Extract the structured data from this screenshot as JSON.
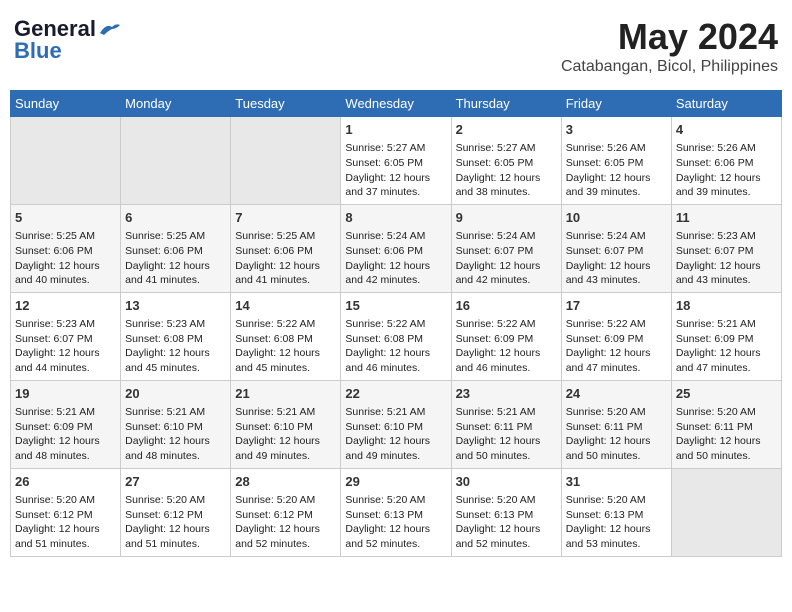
{
  "header": {
    "logo_line1": "General",
    "logo_line2": "Blue",
    "title": "May 2024",
    "subtitle": "Catabangan, Bicol, Philippines"
  },
  "calendar": {
    "days_of_week": [
      "Sunday",
      "Monday",
      "Tuesday",
      "Wednesday",
      "Thursday",
      "Friday",
      "Saturday"
    ],
    "rows": [
      [
        {
          "day": "",
          "info": ""
        },
        {
          "day": "",
          "info": ""
        },
        {
          "day": "",
          "info": ""
        },
        {
          "day": "1",
          "info": "Sunrise: 5:27 AM\nSunset: 6:05 PM\nDaylight: 12 hours\nand 37 minutes."
        },
        {
          "day": "2",
          "info": "Sunrise: 5:27 AM\nSunset: 6:05 PM\nDaylight: 12 hours\nand 38 minutes."
        },
        {
          "day": "3",
          "info": "Sunrise: 5:26 AM\nSunset: 6:05 PM\nDaylight: 12 hours\nand 39 minutes."
        },
        {
          "day": "4",
          "info": "Sunrise: 5:26 AM\nSunset: 6:06 PM\nDaylight: 12 hours\nand 39 minutes."
        }
      ],
      [
        {
          "day": "5",
          "info": "Sunrise: 5:25 AM\nSunset: 6:06 PM\nDaylight: 12 hours\nand 40 minutes."
        },
        {
          "day": "6",
          "info": "Sunrise: 5:25 AM\nSunset: 6:06 PM\nDaylight: 12 hours\nand 41 minutes."
        },
        {
          "day": "7",
          "info": "Sunrise: 5:25 AM\nSunset: 6:06 PM\nDaylight: 12 hours\nand 41 minutes."
        },
        {
          "day": "8",
          "info": "Sunrise: 5:24 AM\nSunset: 6:06 PM\nDaylight: 12 hours\nand 42 minutes."
        },
        {
          "day": "9",
          "info": "Sunrise: 5:24 AM\nSunset: 6:07 PM\nDaylight: 12 hours\nand 42 minutes."
        },
        {
          "day": "10",
          "info": "Sunrise: 5:24 AM\nSunset: 6:07 PM\nDaylight: 12 hours\nand 43 minutes."
        },
        {
          "day": "11",
          "info": "Sunrise: 5:23 AM\nSunset: 6:07 PM\nDaylight: 12 hours\nand 43 minutes."
        }
      ],
      [
        {
          "day": "12",
          "info": "Sunrise: 5:23 AM\nSunset: 6:07 PM\nDaylight: 12 hours\nand 44 minutes."
        },
        {
          "day": "13",
          "info": "Sunrise: 5:23 AM\nSunset: 6:08 PM\nDaylight: 12 hours\nand 45 minutes."
        },
        {
          "day": "14",
          "info": "Sunrise: 5:22 AM\nSunset: 6:08 PM\nDaylight: 12 hours\nand 45 minutes."
        },
        {
          "day": "15",
          "info": "Sunrise: 5:22 AM\nSunset: 6:08 PM\nDaylight: 12 hours\nand 46 minutes."
        },
        {
          "day": "16",
          "info": "Sunrise: 5:22 AM\nSunset: 6:09 PM\nDaylight: 12 hours\nand 46 minutes."
        },
        {
          "day": "17",
          "info": "Sunrise: 5:22 AM\nSunset: 6:09 PM\nDaylight: 12 hours\nand 47 minutes."
        },
        {
          "day": "18",
          "info": "Sunrise: 5:21 AM\nSunset: 6:09 PM\nDaylight: 12 hours\nand 47 minutes."
        }
      ],
      [
        {
          "day": "19",
          "info": "Sunrise: 5:21 AM\nSunset: 6:09 PM\nDaylight: 12 hours\nand 48 minutes."
        },
        {
          "day": "20",
          "info": "Sunrise: 5:21 AM\nSunset: 6:10 PM\nDaylight: 12 hours\nand 48 minutes."
        },
        {
          "day": "21",
          "info": "Sunrise: 5:21 AM\nSunset: 6:10 PM\nDaylight: 12 hours\nand 49 minutes."
        },
        {
          "day": "22",
          "info": "Sunrise: 5:21 AM\nSunset: 6:10 PM\nDaylight: 12 hours\nand 49 minutes."
        },
        {
          "day": "23",
          "info": "Sunrise: 5:21 AM\nSunset: 6:11 PM\nDaylight: 12 hours\nand 50 minutes."
        },
        {
          "day": "24",
          "info": "Sunrise: 5:20 AM\nSunset: 6:11 PM\nDaylight: 12 hours\nand 50 minutes."
        },
        {
          "day": "25",
          "info": "Sunrise: 5:20 AM\nSunset: 6:11 PM\nDaylight: 12 hours\nand 50 minutes."
        }
      ],
      [
        {
          "day": "26",
          "info": "Sunrise: 5:20 AM\nSunset: 6:12 PM\nDaylight: 12 hours\nand 51 minutes."
        },
        {
          "day": "27",
          "info": "Sunrise: 5:20 AM\nSunset: 6:12 PM\nDaylight: 12 hours\nand 51 minutes."
        },
        {
          "day": "28",
          "info": "Sunrise: 5:20 AM\nSunset: 6:12 PM\nDaylight: 12 hours\nand 52 minutes."
        },
        {
          "day": "29",
          "info": "Sunrise: 5:20 AM\nSunset: 6:13 PM\nDaylight: 12 hours\nand 52 minutes."
        },
        {
          "day": "30",
          "info": "Sunrise: 5:20 AM\nSunset: 6:13 PM\nDaylight: 12 hours\nand 52 minutes."
        },
        {
          "day": "31",
          "info": "Sunrise: 5:20 AM\nSunset: 6:13 PM\nDaylight: 12 hours\nand 53 minutes."
        },
        {
          "day": "",
          "info": ""
        }
      ]
    ]
  }
}
